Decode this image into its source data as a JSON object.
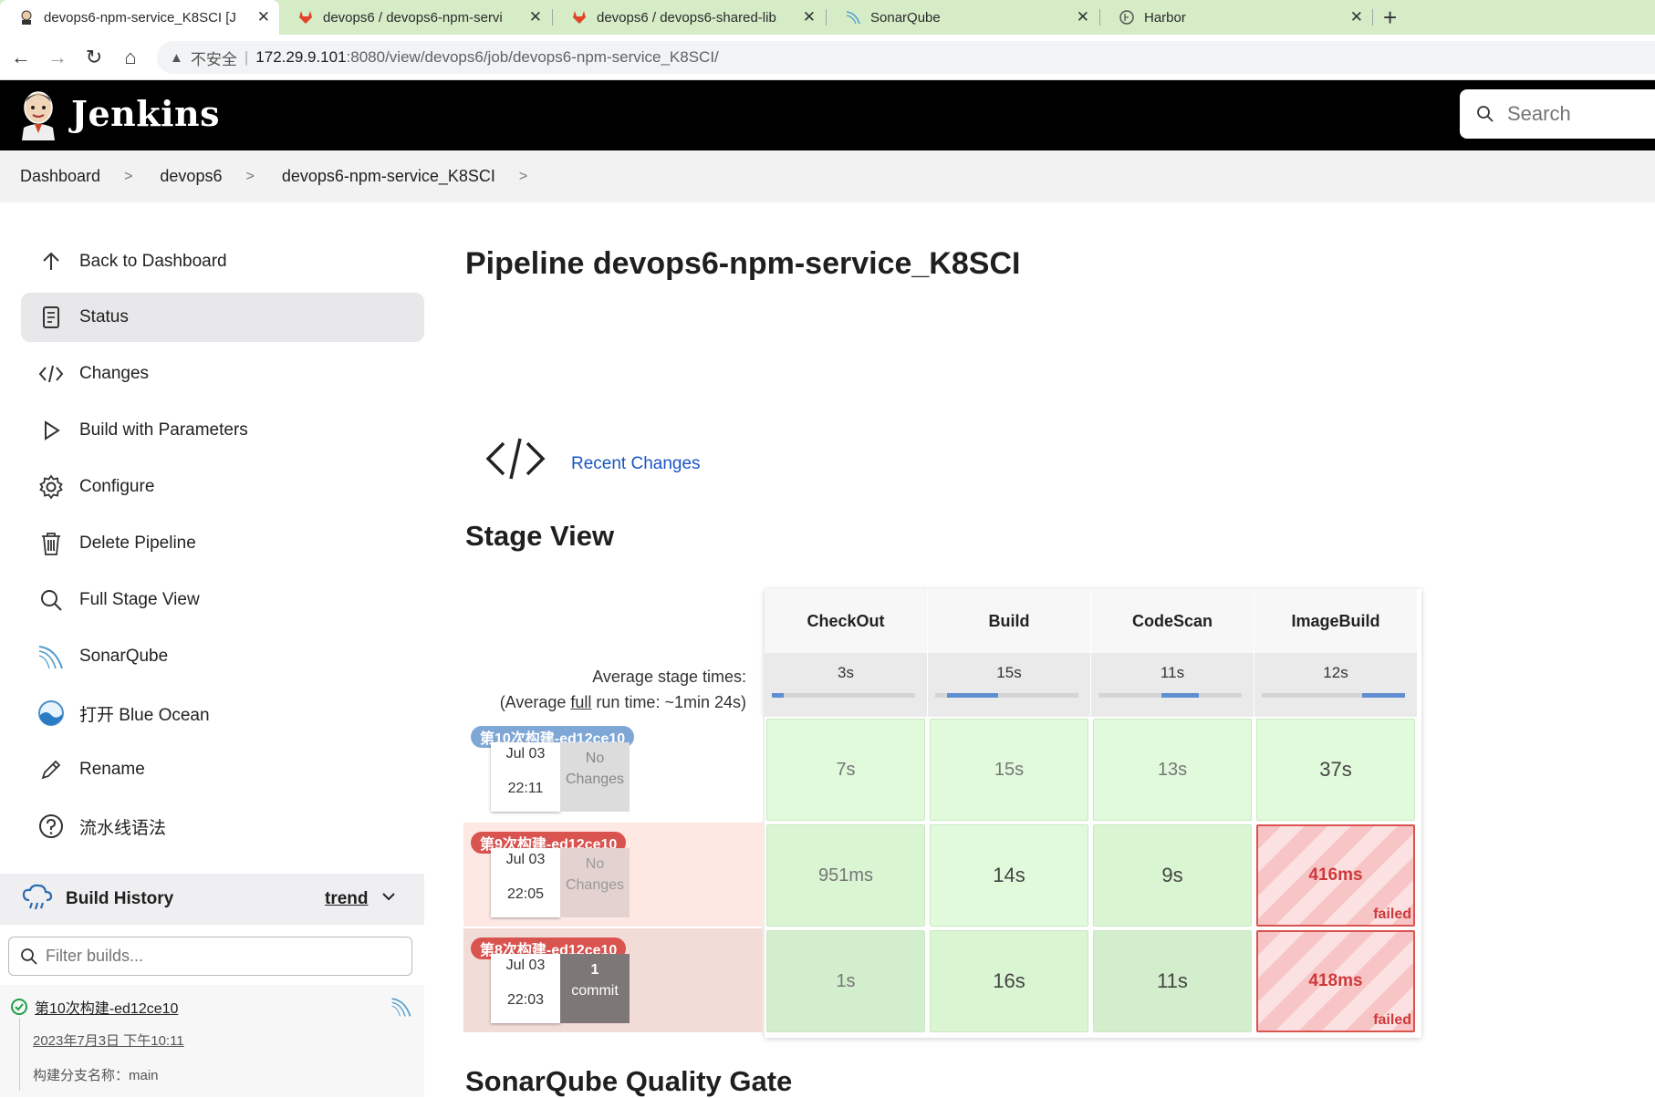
{
  "browser": {
    "tabs": [
      {
        "label": "devops6-npm-service_K8SCI [J",
        "icon": "jenkins-icon",
        "active": true
      },
      {
        "label": "devops6 / devops6-npm-servi",
        "icon": "gitlab-icon",
        "active": false
      },
      {
        "label": "devops6 / devops6-shared-lib",
        "icon": "gitlab-icon",
        "active": false
      },
      {
        "label": "SonarQube",
        "icon": "sonarqube-icon",
        "active": false
      },
      {
        "label": "Harbor",
        "icon": "harbor-icon",
        "active": false
      }
    ],
    "address": {
      "insecure_label": "不安全",
      "host": "172.29.9.101",
      "path": ":8080/view/devops6/job/devops6-npm-service_K8SCI/"
    }
  },
  "header": {
    "title": "Jenkins",
    "search_placeholder": "Search"
  },
  "breadcrumb": [
    "Dashboard",
    "devops6",
    "devops6-npm-service_K8SCI"
  ],
  "sidebar": {
    "items": [
      {
        "label": "Back to Dashboard",
        "icon": "arrow-up-icon"
      },
      {
        "label": "Status",
        "icon": "document-icon",
        "active": true
      },
      {
        "label": "Changes",
        "icon": "code-icon"
      },
      {
        "label": "Build with Parameters",
        "icon": "play-icon"
      },
      {
        "label": "Configure",
        "icon": "gear-icon"
      },
      {
        "label": "Delete Pipeline",
        "icon": "trash-icon"
      },
      {
        "label": "Full Stage View",
        "icon": "search-icon"
      },
      {
        "label": "SonarQube",
        "icon": "sonarqube-icon"
      },
      {
        "label": "打开 Blue Ocean",
        "icon": "blue-ocean-icon"
      },
      {
        "label": "Rename",
        "icon": "pencil-icon"
      },
      {
        "label": "流水线语法",
        "icon": "help-icon"
      }
    ]
  },
  "build_history": {
    "title": "Build History",
    "trend_label": "trend",
    "filter_placeholder": "Filter builds...",
    "entry": {
      "name": "第10次构建-ed12ce10",
      "date": "2023年7月3日 下午10:11",
      "branch": "构建分支名称：main"
    }
  },
  "main": {
    "title": "Pipeline devops6-npm-service_K8SCI",
    "recent_changes": "Recent Changes",
    "stage_view_title": "Stage View",
    "sonar_title": "SonarQube Quality Gate"
  },
  "stage_view": {
    "avg_label_line1": "Average stage times:",
    "avg_label_line2_prefix": "(Average ",
    "avg_label_full": "full",
    "avg_label_line2_suffix": " run time: ~1min 24s)",
    "stages": [
      {
        "name": "CheckOut",
        "avg": "3s",
        "bar_start": 0.0,
        "bar_fraction": 0.08
      },
      {
        "name": "Build",
        "avg": "15s",
        "bar_start": 0.08,
        "bar_fraction": 0.36
      },
      {
        "name": "CodeScan",
        "avg": "11s",
        "bar_start": 0.44,
        "bar_fraction": 0.26
      },
      {
        "name": "ImageBuild",
        "avg": "12s",
        "bar_start": 0.7,
        "bar_fraction": 0.3
      }
    ],
    "runs": [
      {
        "badge": "第10次构建-ed12ce10",
        "badge_color": "#7fa7d6",
        "date": "Jul 03",
        "time": "22:11",
        "changes": "No Changes",
        "changes_kind": "none",
        "row_bg": "#ffffff",
        "cells": [
          {
            "value": "7s",
            "status": "success"
          },
          {
            "value": "15s",
            "status": "success"
          },
          {
            "value": "13s",
            "status": "success"
          },
          {
            "value": "37s",
            "status": "success",
            "emphasis": true
          }
        ]
      },
      {
        "badge": "第9次构建-ed12ce10",
        "badge_color": "#d9534f",
        "date": "Jul 03",
        "time": "22:05",
        "changes": "No Changes",
        "changes_kind": "none",
        "row_bg": "#fde8e4",
        "cells": [
          {
            "value": "951ms",
            "status": "success"
          },
          {
            "value": "14s",
            "status": "success",
            "emphasis": true
          },
          {
            "value": "9s",
            "status": "success",
            "emphasis": true
          },
          {
            "value": "416ms",
            "status": "failed",
            "label": "failed"
          }
        ]
      },
      {
        "badge": "第8次构建-ed12ce10",
        "badge_color": "#d9534f",
        "date": "Jul 03",
        "time": "22:03",
        "changes_count": "1",
        "changes": "commit",
        "changes_kind": "commit",
        "row_bg": "#f2dcd8",
        "cells": [
          {
            "value": "1s",
            "status": "success"
          },
          {
            "value": "16s",
            "status": "success",
            "emphasis": true
          },
          {
            "value": "11s",
            "status": "success",
            "emphasis": true
          },
          {
            "value": "418ms",
            "status": "failed",
            "label": "failed"
          }
        ]
      }
    ]
  }
}
